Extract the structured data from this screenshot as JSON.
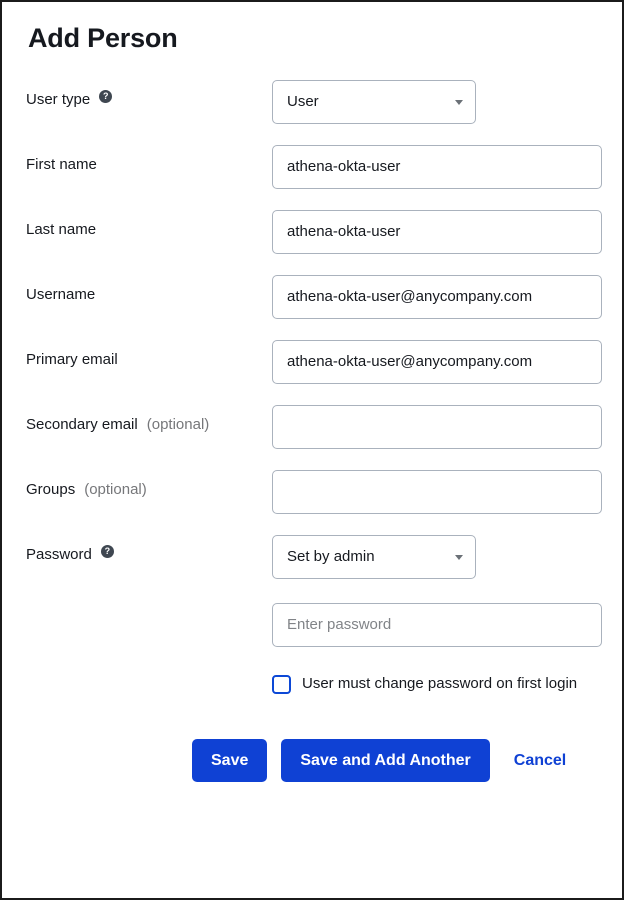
{
  "page": {
    "title": "Add Person"
  },
  "help_icon_glyph": "?",
  "fields": {
    "user_type": {
      "label": "User type",
      "has_help": true,
      "control": "select",
      "value": "User"
    },
    "first_name": {
      "label": "First name",
      "control": "text",
      "value": "athena-okta-user",
      "placeholder": ""
    },
    "last_name": {
      "label": "Last name",
      "control": "text",
      "value": "athena-okta-user",
      "placeholder": ""
    },
    "username": {
      "label": "Username",
      "control": "text",
      "value": "athena-okta-user@anycompany.com",
      "placeholder": ""
    },
    "primary_email": {
      "label": "Primary email",
      "control": "text",
      "value": "athena-okta-user@anycompany.com",
      "placeholder": ""
    },
    "secondary_email": {
      "label": "Secondary email",
      "optional_suffix": "(optional)",
      "control": "text",
      "value": "",
      "placeholder": ""
    },
    "groups": {
      "label": "Groups",
      "optional_suffix": "(optional)",
      "control": "text",
      "value": "",
      "placeholder": ""
    },
    "password": {
      "label": "Password",
      "has_help": true,
      "mode_value": "Set by admin",
      "password_placeholder": "Enter password",
      "password_value": "",
      "force_change_label": "User must change password on first login",
      "force_change_checked": false
    }
  },
  "actions": {
    "save_label": "Save",
    "save_add_another_label": "Save and Add Another",
    "cancel_label": "Cancel"
  },
  "colors": {
    "accent": "#0f41d4",
    "text": "#16191f",
    "muted": "#76777a",
    "border": "#aab2bd"
  }
}
